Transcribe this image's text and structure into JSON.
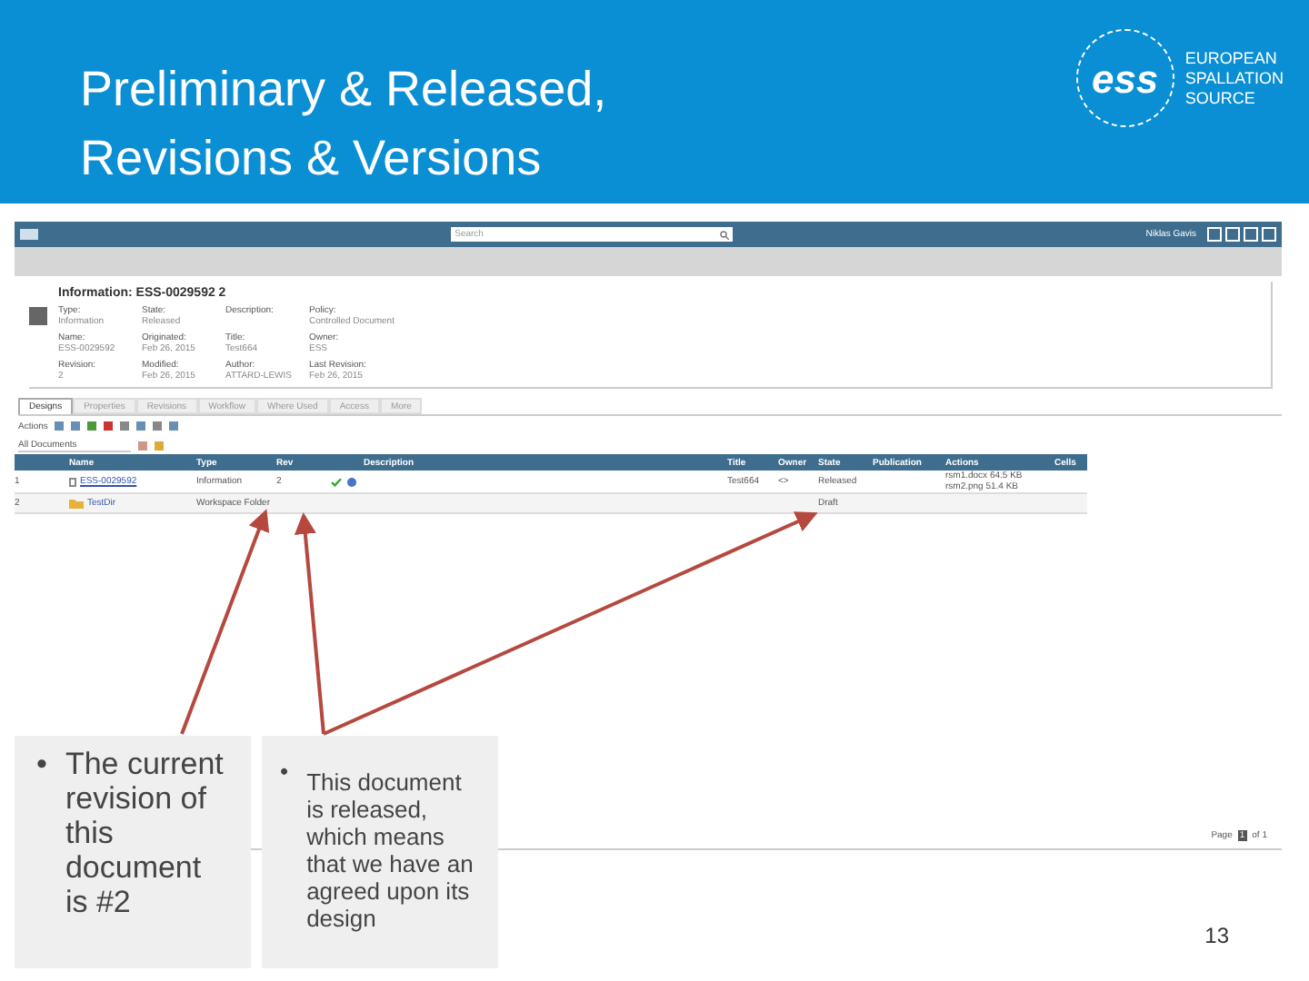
{
  "slide": {
    "title_lines": [
      "Preliminary & Released,",
      "Revisions & Versions"
    ],
    "logo_mark": "ess",
    "logo_lines": [
      "EUROPEAN",
      "SPALLATION",
      "SOURCE"
    ],
    "page_number": "13"
  },
  "app": {
    "search": {
      "placeholder": "Search"
    },
    "user": "Niklas Gavis",
    "object_title": "Information: ESS-0029592 2",
    "fields": [
      {
        "label": "Type:",
        "value": "Information"
      },
      {
        "label": "State:",
        "value": "Released"
      },
      {
        "label": "Description:"
      },
      {
        "label": "Policy:",
        "value": "Controlled Document"
      },
      {
        "label": "Name:",
        "value": "ESS-0029592"
      },
      {
        "label": "Originated:",
        "value": "Feb 26, 2015"
      },
      {
        "label": "Title:",
        "value": "Test664"
      },
      {
        "label": "Owner:",
        "value": "ESS"
      },
      {
        "label": "Revision:",
        "value": "2"
      },
      {
        "label": "Modified:",
        "value": "Feb 26, 2015"
      },
      {
        "label": "Author:",
        "value": "ATTARD-LEWIS"
      },
      {
        "label": "Last Revision:",
        "value": "Feb 26, 2015"
      }
    ],
    "tabs": [
      {
        "label": "Designs",
        "selected": true
      },
      {
        "label": "Properties",
        "selected": false
      },
      {
        "label": "Revisions",
        "selected": false
      },
      {
        "label": "Workflow",
        "selected": false
      },
      {
        "label": "Where Used",
        "selected": false
      },
      {
        "label": "Access",
        "selected": false
      },
      {
        "label": "More",
        "selected": false
      }
    ],
    "actions_label": "Actions",
    "filter_value": "All Documents",
    "columns": [
      "Name",
      "Type",
      "Rev",
      "Description",
      "Title",
      "Owner",
      "State",
      "Publication",
      "Actions",
      "Cells"
    ],
    "rows": [
      {
        "number": "1",
        "name": "ESS-0029592",
        "type": "Information",
        "rev": "2",
        "released": true,
        "title": "Test664",
        "owner": "<>",
        "state": "Released",
        "files": [
          "rsm1.docx 64.5 KB",
          "rsm2.png 51.4 KB"
        ]
      },
      {
        "number": "2",
        "name": "TestDir",
        "type": "Workspace Folder",
        "rev": "",
        "released": false,
        "title": "",
        "owner": "",
        "state": "Draft",
        "files": []
      }
    ],
    "pager": {
      "label": "Page",
      "current": "1",
      "total": "of 1"
    }
  },
  "callouts": [
    {
      "bullet": "•",
      "text": "The current revision of this document is #2"
    },
    {
      "bullet": "•",
      "text": "This document is released, which means that we have an agreed upon its design"
    }
  ]
}
